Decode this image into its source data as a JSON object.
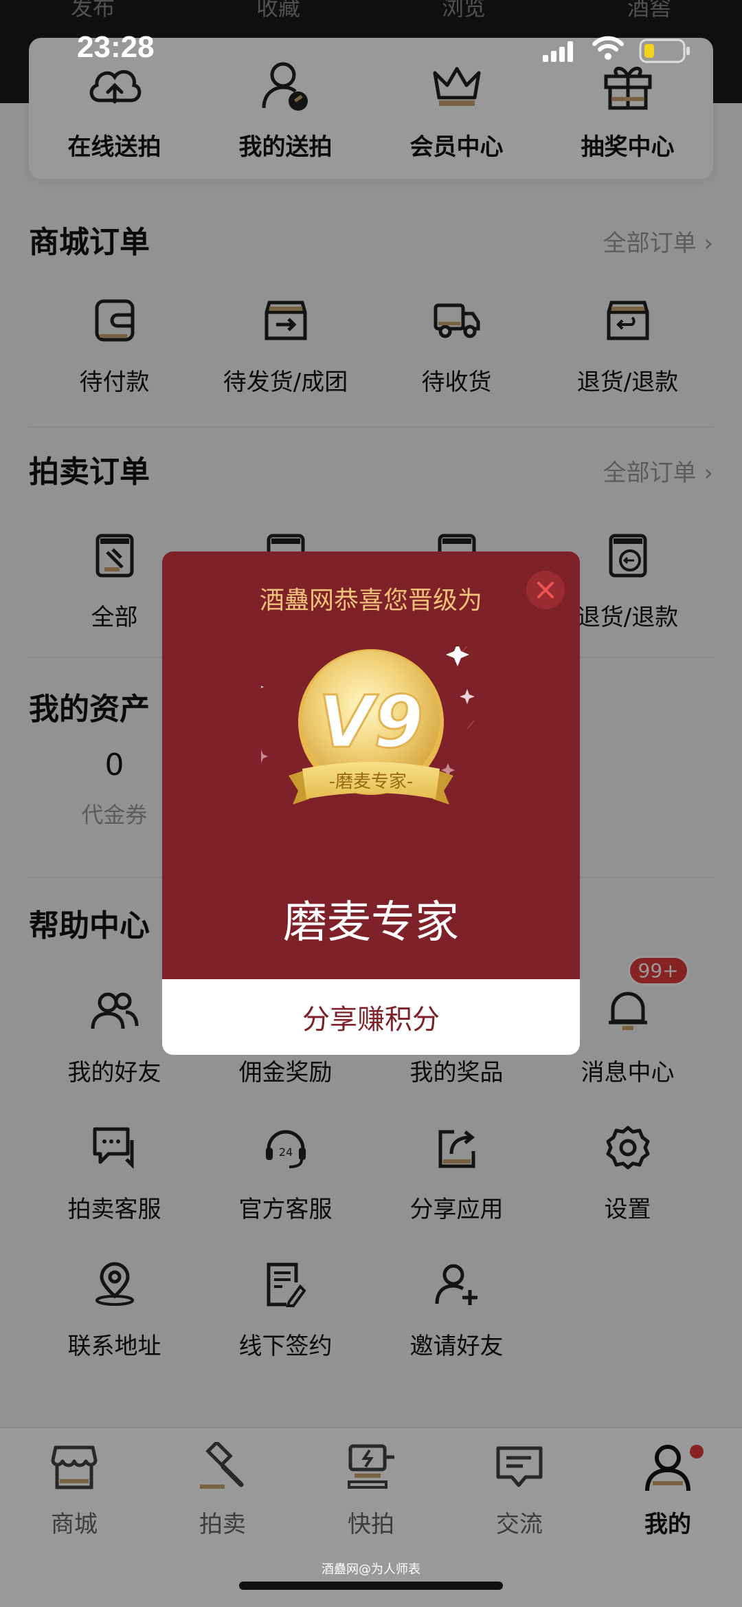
{
  "top_tabs": [
    "发布",
    "收藏",
    "浏览",
    "酒窖"
  ],
  "status_bar": {
    "time": "23:28"
  },
  "quick_actions": [
    {
      "label": "在线送拍",
      "icon": "cloud-upload-icon"
    },
    {
      "label": "我的送拍",
      "icon": "user-auction-icon"
    },
    {
      "label": "会员中心",
      "icon": "crown-icon"
    },
    {
      "label": "抽奖中心",
      "icon": "gift-icon"
    }
  ],
  "mall_orders": {
    "title": "商城订单",
    "more": "全部订单 ›",
    "items": [
      {
        "label": "待付款",
        "icon": "wallet-icon"
      },
      {
        "label": "待发货/成团",
        "icon": "box-out-icon"
      },
      {
        "label": "待收货",
        "icon": "truck-icon"
      },
      {
        "label": "退货/退款",
        "icon": "box-return-icon"
      }
    ]
  },
  "auction_orders": {
    "title": "拍卖订单",
    "more": "全部订单 ›",
    "items": [
      {
        "label": "全部",
        "icon": "auction-all-icon"
      },
      {
        "label": "",
        "icon": "auction-doc-icon"
      },
      {
        "label": "",
        "icon": "auction-doc-icon"
      },
      {
        "label": "退货/退款",
        "icon": "auction-return-icon"
      }
    ]
  },
  "assets": {
    "title": "我的资产",
    "items": [
      {
        "value": "0",
        "label": "代金券"
      }
    ]
  },
  "help_center": {
    "title": "帮助中心",
    "rows": [
      [
        {
          "label": "我的好友",
          "icon": "friends-icon"
        },
        {
          "label": "佣金奖励",
          "icon": "commission-icon"
        },
        {
          "label": "我的奖品",
          "icon": "prize-icon"
        },
        {
          "label": "消息中心",
          "icon": "bell-icon",
          "badge": "99+"
        }
      ],
      [
        {
          "label": "拍卖客服",
          "icon": "chat-icon"
        },
        {
          "label": "官方客服",
          "icon": "headset-icon"
        },
        {
          "label": "分享应用",
          "icon": "share-icon"
        },
        {
          "label": "设置",
          "icon": "gear-icon"
        }
      ],
      [
        {
          "label": "联系地址",
          "icon": "location-icon"
        },
        {
          "label": "线下签约",
          "icon": "contract-icon"
        },
        {
          "label": "邀请好友",
          "icon": "invite-icon"
        }
      ]
    ]
  },
  "tabbar": [
    {
      "label": "商城",
      "icon": "shop-icon",
      "active": false
    },
    {
      "label": "拍卖",
      "icon": "gavel-icon",
      "active": false
    },
    {
      "label": "快拍",
      "icon": "quick-auction-icon",
      "active": false
    },
    {
      "label": "交流",
      "icon": "message-icon",
      "active": false
    },
    {
      "label": "我的",
      "icon": "profile-icon",
      "active": true
    }
  ],
  "watermark": "酒蠱网@为人师表",
  "modal": {
    "heading": "酒蠱网恭喜您晋级为",
    "level": "V9",
    "ribbon": "-磨麦专家-",
    "level_name": "磨麦专家",
    "share_button": "分享赚积分"
  },
  "colors": {
    "modal_bg": "#7e2129",
    "heading_gold": "#f1c27a",
    "badge_red": "#e33b3b",
    "icon_gold": "#c8a46a"
  }
}
